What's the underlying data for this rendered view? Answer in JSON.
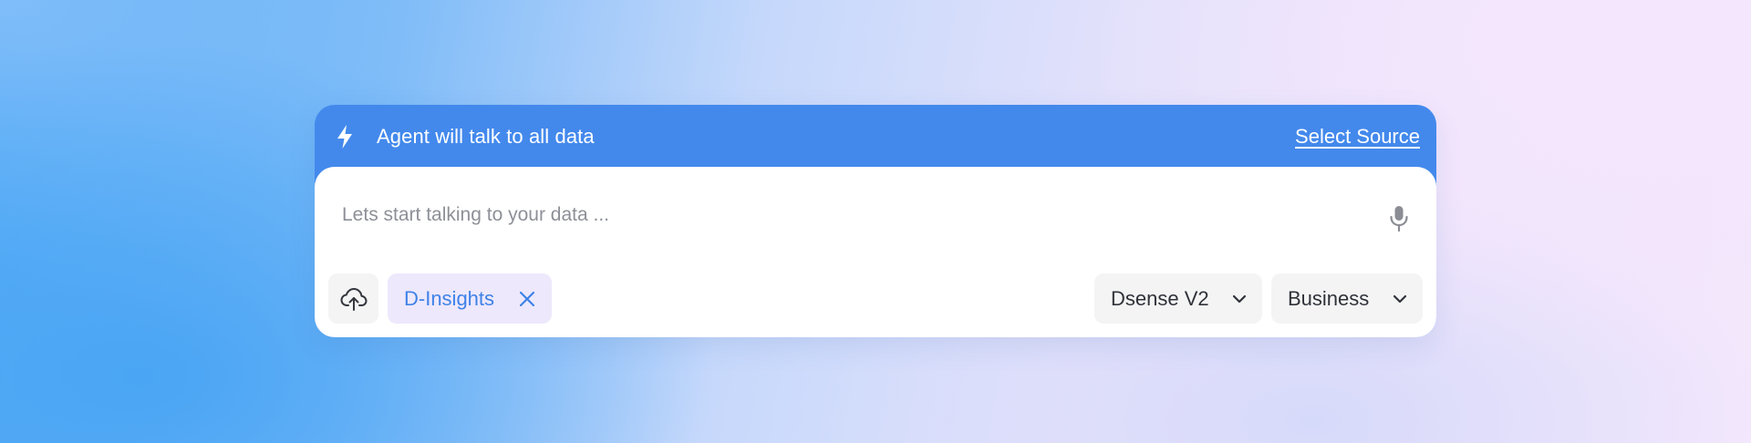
{
  "banner": {
    "icon": "bolt-icon",
    "text": "Agent will talk to all data",
    "select_source_label": "Select Source"
  },
  "prompt": {
    "placeholder": "Lets start talking to your data ...",
    "value": "",
    "mic_icon": "microphone-icon"
  },
  "toolbar": {
    "upload_icon": "cloud-upload-icon",
    "chip": {
      "label": "D-Insights",
      "close_icon": "close-icon"
    },
    "model_select": {
      "value": "Dsense V2",
      "icon": "chevron-down-icon"
    },
    "mode_select": {
      "value": "Business",
      "icon": "chevron-down-icon"
    }
  },
  "colors": {
    "accent": "#4389ec",
    "chip_bg": "#ede8fb",
    "chip_text": "#3e82e8",
    "control_bg": "#f4f4f5"
  }
}
